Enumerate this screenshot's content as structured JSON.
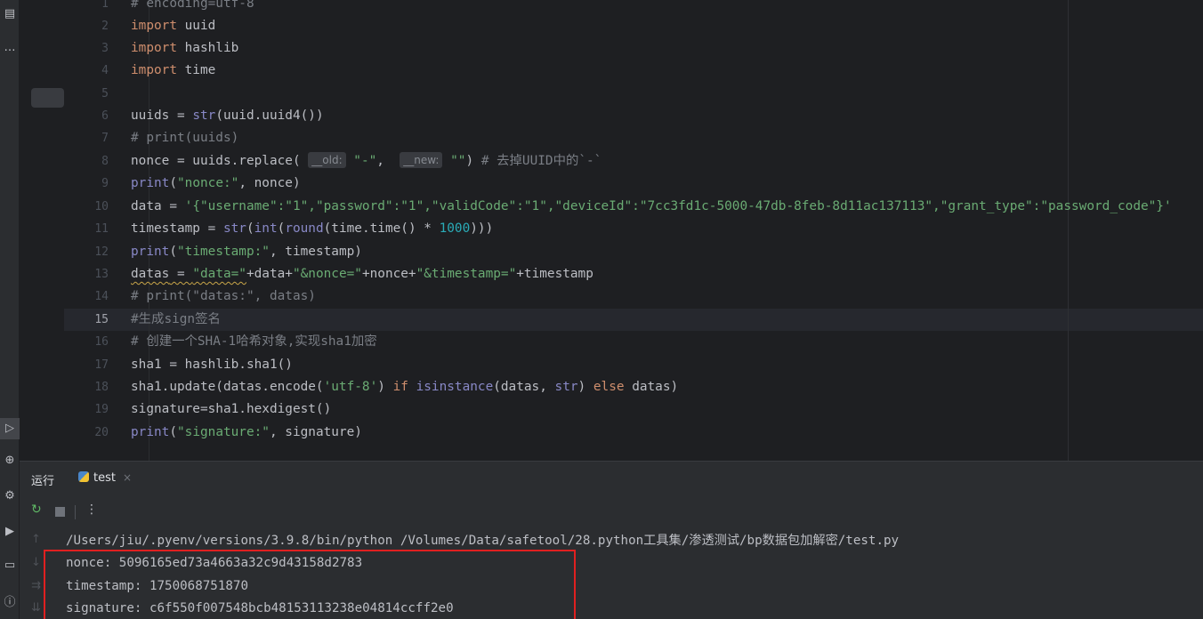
{
  "toolstrip": {
    "icons": [
      "structure-icon",
      "more-icon",
      "run-icon",
      "python-packages-icon",
      "services-icon",
      "debug-icon",
      "terminal-icon",
      "problems-icon"
    ],
    "more_glyph": "…"
  },
  "editor": {
    "current_line": 15,
    "line_numbers": [
      "1",
      "2",
      "3",
      "4",
      "5",
      "6",
      "7",
      "8",
      "9",
      "10",
      "11",
      "12",
      "13",
      "14",
      "15",
      "16",
      "17",
      "18",
      "19",
      "20"
    ],
    "lines": [
      "# encoding=utf-8",
      "import uuid",
      "import hashlib",
      "import time",
      "",
      "uuids = str(uuid.uuid4())",
      "# print(uuids)",
      "nonce = uuids.replace( __old: \"-\",  __new: \"\") # 去掉UUID中的`-`",
      "print(\"nonce:\", nonce)",
      "data = '{\"username\":\"1\",\"password\":\"1\",\"validCode\":\"1\",\"deviceId\":\"7cc3fd1c-5000-47db-8feb-8d11ac137113\",\"grant_type\":\"password_code\"}'",
      "timestamp = str(int(round(time.time() * 1000)))",
      "print(\"timestamp:\", timestamp)",
      "datas = \"data=\"+data+\"&nonce=\"+nonce+\"&timestamp=\"+timestamp",
      "# print(\"datas:\", datas)",
      "#生成sign签名",
      "# 创建一个SHA-1哈希对象,实现sha1加密",
      "sha1 = hashlib.sha1()",
      "sha1.update(datas.encode('utf-8') if isinstance(datas, str) else datas)",
      "signature=sha1.hexdigest()",
      "print(\"signature:\", signature)"
    ],
    "tokens": {
      "l1": "# encoding=utf-8",
      "import": "import",
      "uuid": " uuid",
      "hashlib": " hashlib",
      "time": " time",
      "l6a": "uuids = ",
      "l6b": "str",
      "l6c": "(uuid.uuid4())",
      "l7": "# print(uuids)",
      "l8a": "nonce = uuids.replace( ",
      "l8h1": "__old:",
      "l8s1": " \"-\"",
      "l8c": ",  ",
      "l8h2": "__new:",
      "l8s2": " \"\"",
      "l8d": ") ",
      "l8cm": "# 去掉UUID中的`-`",
      "print": "print",
      "l9a": "(",
      "l9s": "\"nonce:\"",
      "l9b": ", nonce)",
      "l10a": "data = ",
      "l10s": "'{\"username\":\"1\",\"password\":\"1\",\"validCode\":\"1\",\"deviceId\":\"7cc3fd1c-5000-47db-8feb-8d11ac137113\",\"grant_type\":\"password_code\"}'",
      "l11a": "timestamp = ",
      "l11b": "str",
      "l11c": "(",
      "l11d": "int",
      "l11e": "(",
      "l11f": "round",
      "l11g": "(time.time() * ",
      "l11n": "1000",
      "l11h": ")))",
      "l12s": "\"timestamp:\"",
      "l12b": ", timestamp)",
      "l13a": "datas",
      "l13b": " = ",
      "l13s1": "\"data=\"",
      "l13c": "+data+",
      "l13s2": "\"&nonce=\"",
      "l13d": "+nonce+",
      "l13s3": "\"&timestamp=\"",
      "l13e": "+timestamp",
      "l14": "# print(\"datas:\", datas)",
      "l15": "#生成sign签名",
      "l16": "# 创建一个SHA-1哈希对象,实现sha1加密",
      "l17": "sha1 = hashlib.sha1()",
      "l18a": "sha1.update(datas.encode(",
      "l18s": "'utf-8'",
      "l18b": ") ",
      "l18if": "if",
      "l18c": " ",
      "l18isi": "isinstance",
      "l18d": "(datas, ",
      "l18str": "str",
      "l18e": ") ",
      "l18else": "else",
      "l18f": " datas)",
      "l19": "signature=sha1.hexdigest()",
      "l20s": "\"signature:\"",
      "l20b": ", signature)"
    }
  },
  "run_panel": {
    "title": "运行",
    "tab_label": "test",
    "tab_close": "×",
    "toolbar": {
      "rerun_glyph": "↻",
      "more_glyph": "⋮"
    },
    "gutter_glyphs": [
      "↑",
      "↓",
      "⇉",
      "⇊"
    ],
    "console_lines": [
      "/Users/jiu/.pyenv/versions/3.9.8/bin/python /Volumes/Data/safetool/28.python工具集/渗透测试/bp数据包加解密/test.py",
      "nonce: 5096165ed73a4663a32c9d43158d2783",
      "timestamp: 1750068751870",
      "signature: c6f550f007548bcb48153113238e04814ccff2e0"
    ]
  },
  "colors": {
    "background": "#1e1f22",
    "keyword": "#cf8e6d",
    "builtin": "#8888c6",
    "string": "#6aab73",
    "number": "#2aacb8",
    "comment": "#7a7e85",
    "highlight_box": "#e02020"
  }
}
